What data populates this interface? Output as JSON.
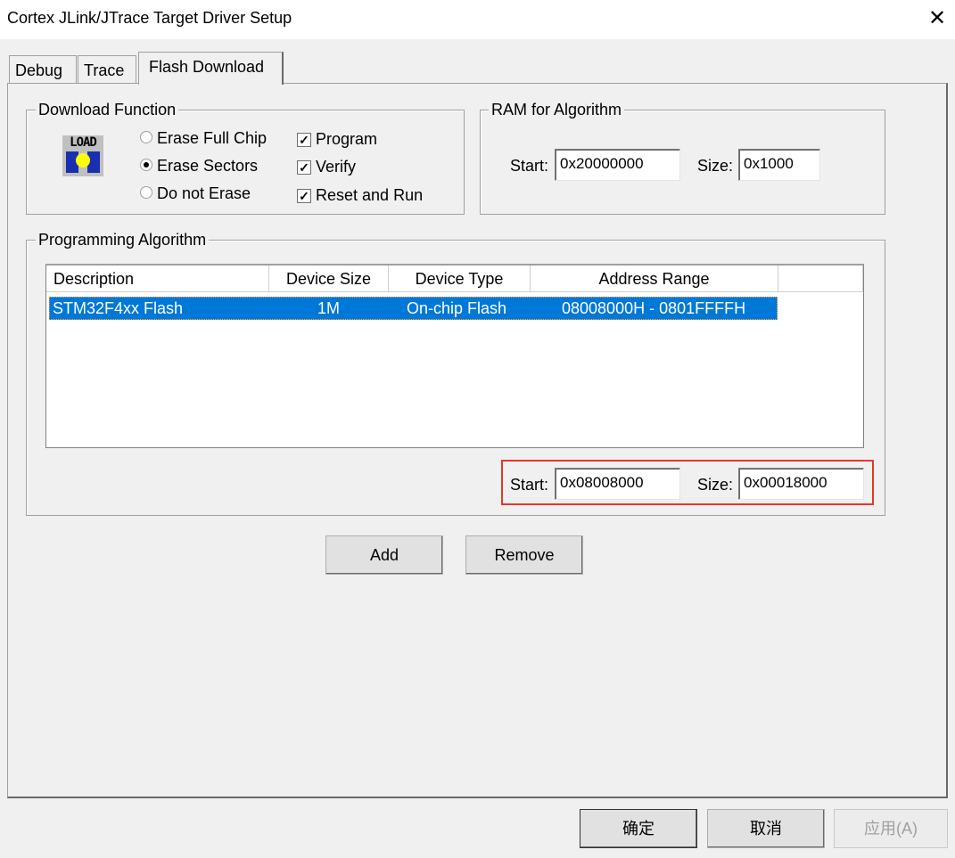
{
  "window": {
    "title": "Cortex JLink/JTrace Target Driver Setup"
  },
  "tabs": [
    {
      "label": "Debug"
    },
    {
      "label": "Trace"
    },
    {
      "label": "Flash Download"
    }
  ],
  "download_function": {
    "legend": "Download Function",
    "icon_text": "LOAD",
    "radios": [
      {
        "label": "Erase Full Chip",
        "checked": false
      },
      {
        "label": "Erase Sectors",
        "checked": true
      },
      {
        "label": "Do not Erase",
        "checked": false
      }
    ],
    "checks": [
      {
        "label": "Program",
        "checked": true
      },
      {
        "label": "Verify",
        "checked": true
      },
      {
        "label": "Reset and Run",
        "checked": true
      }
    ]
  },
  "ram": {
    "legend": "RAM for Algorithm",
    "start_label": "Start:",
    "start": "0x20000000",
    "size_label": "Size:",
    "size": "0x1000"
  },
  "algorithm": {
    "legend": "Programming Algorithm",
    "columns": [
      "Description",
      "Device Size",
      "Device Type",
      "Address Range"
    ],
    "rows": [
      {
        "description": "STM32F4xx Flash",
        "size": "1M",
        "type": "On-chip Flash",
        "range": "08008000H - 0801FFFFH"
      }
    ],
    "start_label": "Start:",
    "start": "0x08008000",
    "size_label": "Size:",
    "size": "0x00018000",
    "highlight_color": "#e8372a"
  },
  "buttons": {
    "add": "Add",
    "remove": "Remove",
    "ok": "确定",
    "cancel": "取消",
    "apply": "应用(A)"
  },
  "colors": {
    "selection": "#0078d7"
  }
}
